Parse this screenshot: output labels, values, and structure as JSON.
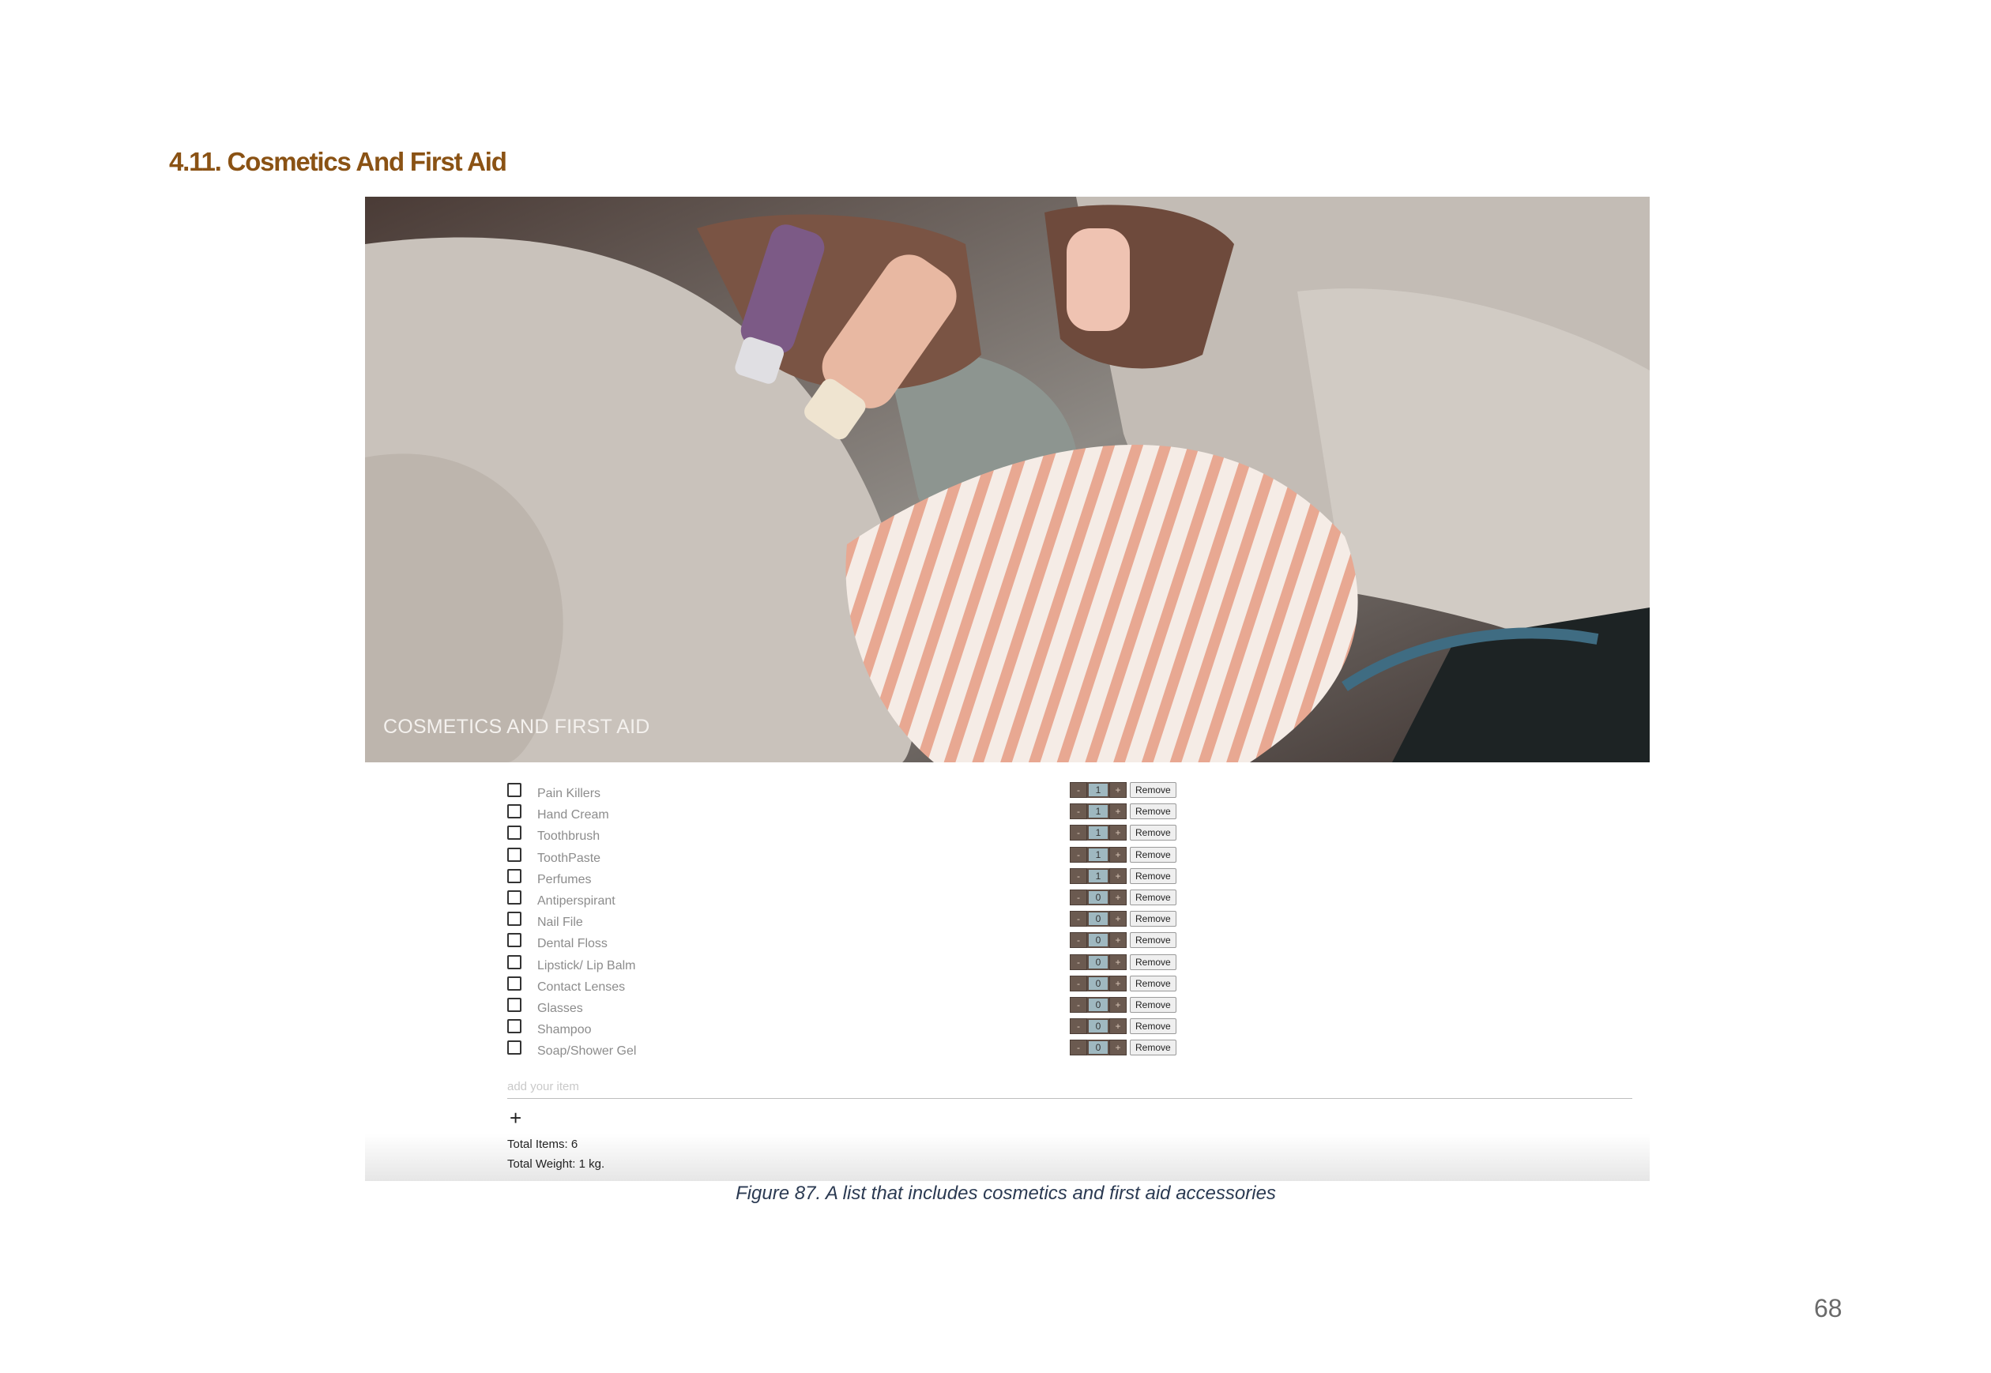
{
  "section_heading": "4.11. Cosmetics And First Aid",
  "hero": {
    "title": "COSMETICS AND FIRST AID"
  },
  "checklist": {
    "items": [
      {
        "label": "Pain Killers",
        "qty": "1"
      },
      {
        "label": "Hand Cream",
        "qty": "1"
      },
      {
        "label": "Toothbrush",
        "qty": "1"
      },
      {
        "label": "ToothPaste",
        "qty": "1"
      },
      {
        "label": "Perfumes",
        "qty": "1"
      },
      {
        "label": "Antiperspirant",
        "qty": "0"
      },
      {
        "label": "Nail File",
        "qty": "0"
      },
      {
        "label": "Dental Floss",
        "qty": "0"
      },
      {
        "label": "Lipstick/ Lip Balm",
        "qty": "0"
      },
      {
        "label": "Contact Lenses",
        "qty": "0"
      },
      {
        "label": "Glasses",
        "qty": "0"
      },
      {
        "label": "Shampoo",
        "qty": "0"
      },
      {
        "label": "Soap/Shower Gel",
        "qty": "0"
      }
    ],
    "minus_label": "-",
    "plus_label": "+",
    "remove_label": "Remove",
    "add_placeholder": "add your item",
    "add_button_label": "+"
  },
  "totals": {
    "items": "Total Items: 6",
    "weight": "Total Weight: 1 kg."
  },
  "caption": "Figure 87. A list that includes cosmetics and first aid accessories",
  "page_number": "68"
}
